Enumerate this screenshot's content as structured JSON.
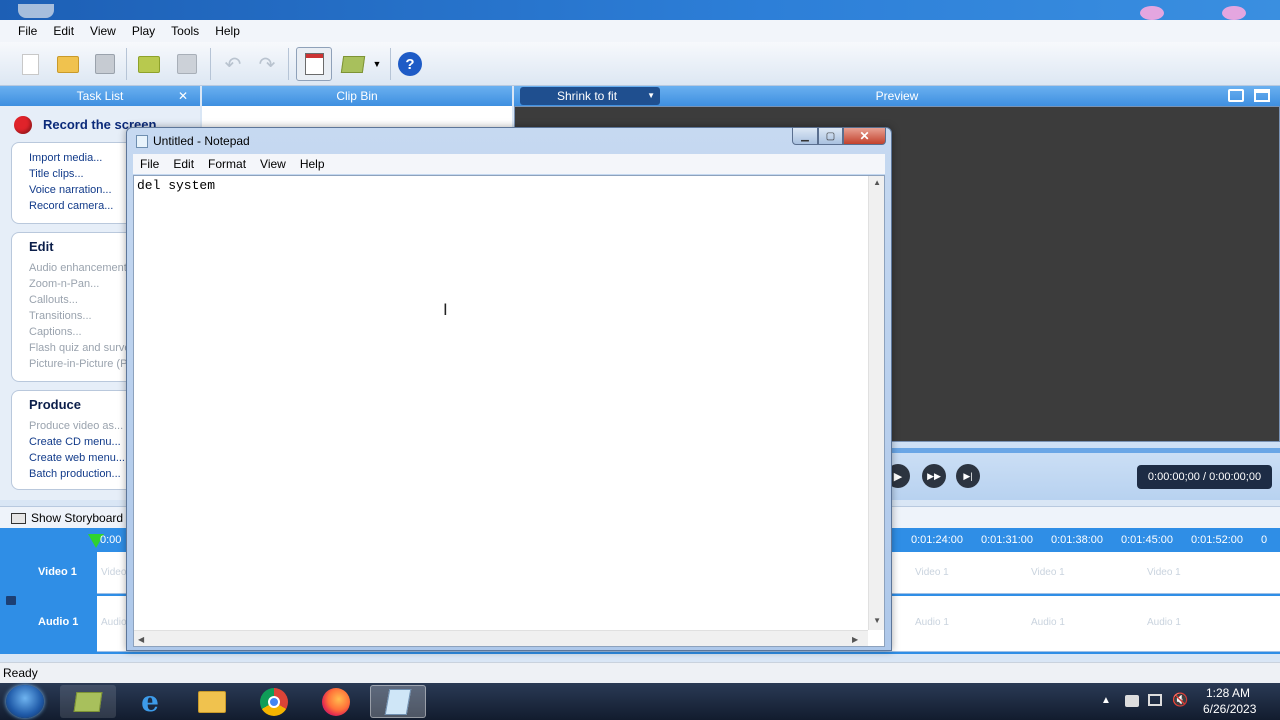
{
  "app": {
    "menu": [
      "File",
      "Edit",
      "View",
      "Play",
      "Tools",
      "Help"
    ],
    "panels": {
      "task_list": "Task List",
      "clip_bin": "Clip Bin",
      "preview": "Preview",
      "zoom_select": "Shrink to fit"
    },
    "task_list": {
      "record_label": "Record the screen",
      "record_items": [
        "Import media...",
        "Title clips...",
        "Voice narration...",
        "Record camera..."
      ],
      "edit_title": "Edit",
      "edit_items": [
        "Audio enhancements...",
        "Zoom-n-Pan...",
        "Callouts...",
        "Transitions...",
        "Captions...",
        "Flash quiz and survey...",
        "Picture-in-Picture (PIP)..."
      ],
      "produce_title": "Produce",
      "produce_items": [
        "Produce video as...",
        "Create CD menu...",
        "Create web menu...",
        "Batch production..."
      ]
    },
    "preview": {
      "time": "0:00:00;00 / 0:00:00;00"
    },
    "timeline": {
      "show_storyboard": "Show Storyboard",
      "ruler_start": "0:00",
      "ticks": [
        "0:01:24:00",
        "0:01:31:00",
        "0:01:38:00",
        "0:01:45:00",
        "0:01:52:00",
        "0"
      ],
      "tracks": [
        {
          "label": "Video 1",
          "ghost": "Video 1"
        },
        {
          "label": "Audio 1",
          "ghost": "Audio 1"
        }
      ]
    },
    "status": "Ready"
  },
  "notepad": {
    "title": "Untitled - Notepad",
    "menu": [
      "File",
      "Edit",
      "Format",
      "View",
      "Help"
    ],
    "content": "del system"
  },
  "taskbar": {
    "time": "1:28 AM",
    "date": "6/26/2023"
  },
  "colors": {
    "accent": "#3e8fe0",
    "timeline": "#2f8ee6",
    "preview_bg": "#3c3c3c",
    "record_red": "#e0232a",
    "help_blue": "#1e5bc6"
  }
}
